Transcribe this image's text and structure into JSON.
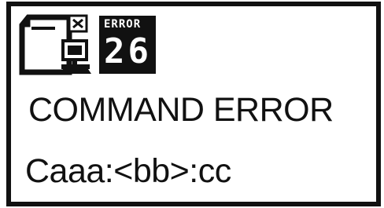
{
  "badge": {
    "label": "ERROR",
    "code": "26"
  },
  "message": {
    "title": "COMMAND ERROR",
    "detail": "Caaa:<bb>:cc"
  },
  "icons": {
    "document": "document-icon",
    "computer": "computer-icon",
    "close": "close-icon"
  }
}
